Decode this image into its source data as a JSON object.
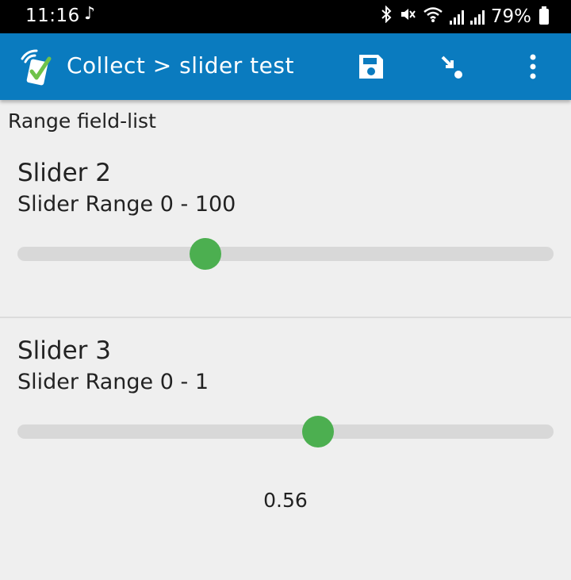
{
  "status_bar": {
    "time": "11:16",
    "battery": "79%",
    "icons": [
      "music-note-icon",
      "bluetooth-icon",
      "mute-icon",
      "wifi-icon",
      "signal-icon",
      "signal-icon",
      "battery-icon"
    ]
  },
  "app_bar": {
    "title": "Collect > slider test",
    "color": "#0a7bbf",
    "actions": [
      "save-icon",
      "jump-to-icon",
      "more-vert-icon"
    ]
  },
  "form": {
    "group_label": "Range field-list",
    "questions": [
      {
        "title": "Slider 2",
        "hint": "Slider Range 0 - 100",
        "min": 0,
        "max": 100,
        "value": 35,
        "value_label": ""
      },
      {
        "title": "Slider 3",
        "hint": "Slider Range 0 - 1",
        "min": 0,
        "max": 1,
        "value": 0.56,
        "value_label": "0.56"
      }
    ],
    "accent_color": "#4caf50"
  }
}
